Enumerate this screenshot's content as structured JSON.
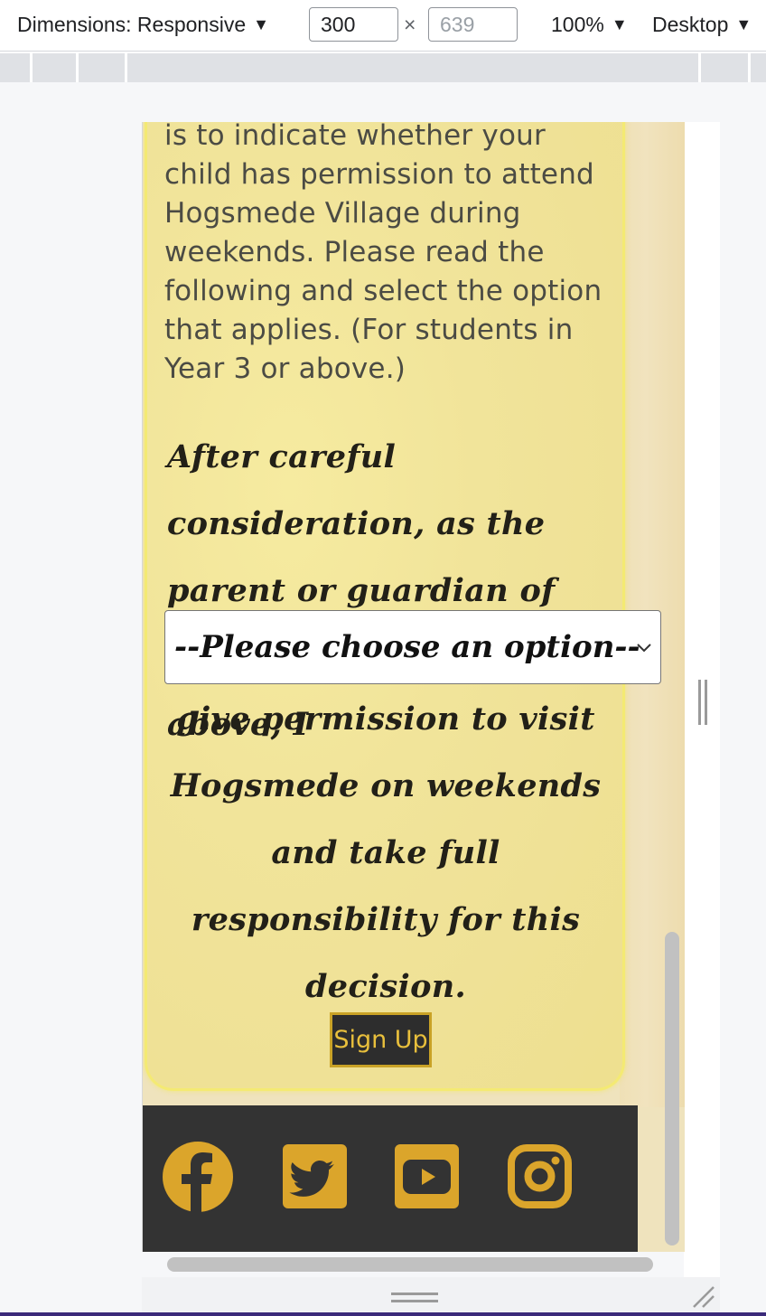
{
  "devtools": {
    "dimensions_label": "Dimensions: Responsive",
    "width_value": "300",
    "height_placeholder": "639",
    "times": "×",
    "zoom": "100%",
    "device_mode": "Desktop",
    "caret": "▼"
  },
  "form": {
    "intro_text": "The following part of the form is to indicate whether your child has permission to attend Hogsmede Village during weekends. Please read the following and select the option that applies. (For students in Year 3 or above.)",
    "consideration_text": "After careful consideration, as the parent or guardian of the student named above, I",
    "select_value": "--Please choose an option--",
    "permission_text": "give permission to visit Hogsmede on weekends and take full responsibility for this decision.",
    "signup_label": "Sign Up"
  },
  "footer": {
    "icons": [
      "facebook-icon",
      "twitter-icon",
      "youtube-icon",
      "instagram-icon"
    ],
    "icon_color": "#dba52b",
    "background": "#333333"
  },
  "colors": {
    "parchment": "#f1e49a",
    "card_border": "#f4ea73",
    "button_border": "#c9a226",
    "button_text": "#e8bf3c"
  }
}
